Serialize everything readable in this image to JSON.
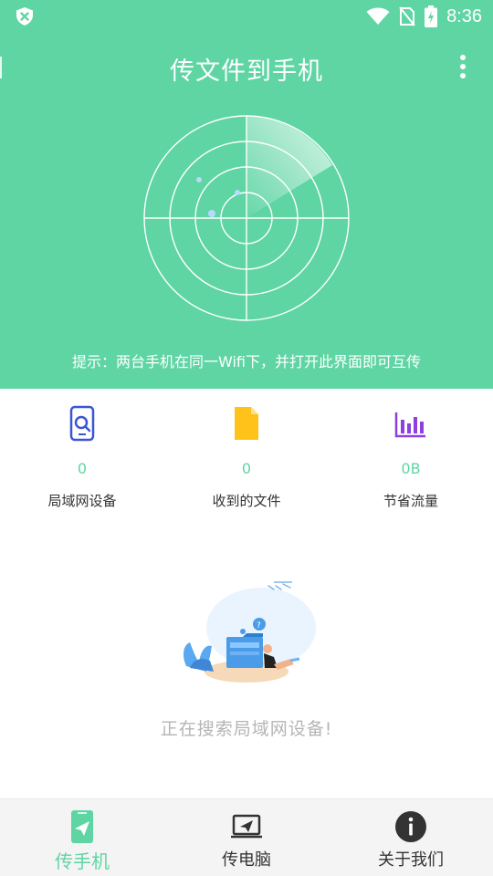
{
  "status_bar": {
    "time": "8:36"
  },
  "header": {
    "title": "传文件到手机",
    "menu_icon": "more-vert-icon"
  },
  "radar": {
    "tip": "提示：两台手机在同一Wifi下，并打开此界面即可互传"
  },
  "stats": [
    {
      "value": "0",
      "label": "局域网设备",
      "icon": "phone-search-icon",
      "color": "#3a56d4"
    },
    {
      "value": "0",
      "label": "收到的文件",
      "icon": "file-icon",
      "color": "#ffc21a"
    },
    {
      "value": "0B",
      "label": "节省流量",
      "icon": "bar-chart-icon",
      "color": "#8e3fe0"
    }
  ],
  "empty_state": {
    "message": "正在搜索局域网设备!"
  },
  "bottom_nav": [
    {
      "label": "传手机",
      "icon": "phone-send-icon",
      "active": true
    },
    {
      "label": "传电脑",
      "icon": "laptop-send-icon",
      "active": false
    },
    {
      "label": "关于我们",
      "icon": "info-icon",
      "active": false
    }
  ],
  "theme": {
    "accent": "#5fd5a3",
    "text": "#333333",
    "muted": "#b5b5b5"
  }
}
